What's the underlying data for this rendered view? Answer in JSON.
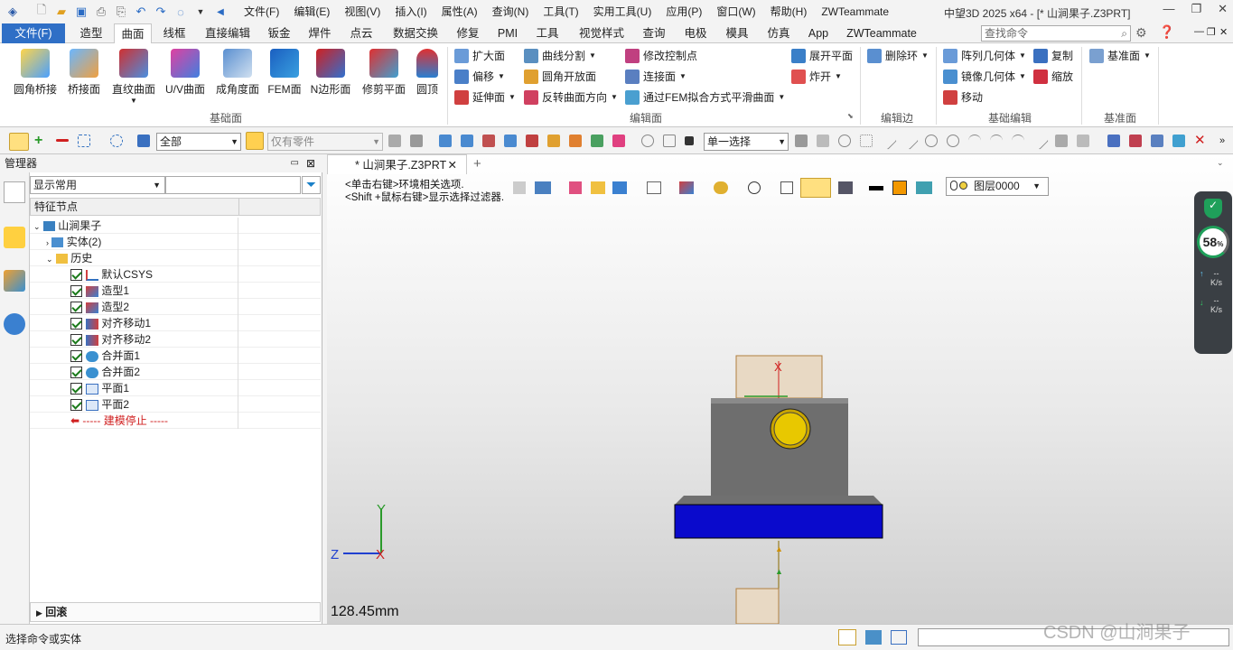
{
  "title_bar": {
    "menus": [
      "文件(F)",
      "编辑(E)",
      "视图(V)",
      "插入(I)",
      "属性(A)",
      "查询(N)",
      "工具(T)",
      "实用工具(U)",
      "应用(P)",
      "窗口(W)",
      "帮助(H)",
      "ZWTeammate"
    ],
    "window_title": "中望3D 2025 x64 - [* 山涧果子.Z3PRT]"
  },
  "ribbon_tabs": [
    "文件(F)",
    "造型",
    "曲面",
    "线框",
    "直接编辑",
    "钣金",
    "焊件",
    "点云",
    "数据交换",
    "修复",
    "PMI",
    "工具",
    "视觉样式",
    "查询",
    "电极",
    "模具",
    "仿真",
    "App",
    "ZWTeammate"
  ],
  "active_tab": "曲面",
  "search_placeholder": "查找命令",
  "ribbon": {
    "big_buttons": [
      "圆角桥接",
      "桥接面",
      "直纹曲面",
      "U/V曲面",
      "成角度面",
      "FEM面",
      "N边形面",
      "修剪平面",
      "圆顶"
    ],
    "group_basic": "基础面",
    "edit_col1": [
      "扩大面",
      "偏移",
      "延伸面"
    ],
    "edit_col2": [
      "曲线分割",
      "圆角开放面",
      "反转曲面方向"
    ],
    "edit_col3": [
      "修改控制点",
      "连接面",
      "通过FEM拟合方式平滑曲面"
    ],
    "edit_col4": [
      "展开平面",
      "炸开"
    ],
    "group_edit_face": "编辑面",
    "delete_loop": "删除环",
    "group_edit_edge": "编辑边",
    "base_edit": [
      "阵列几何体",
      "镜像几何体",
      "移动"
    ],
    "base_edit2": [
      "复制",
      "缩放"
    ],
    "group_base_edit": "基础编辑",
    "datum_plane": "基准面",
    "group_datum": "基准面"
  },
  "toolbar": {
    "filter_all": "全部",
    "filter_part": "仅有零件",
    "select_mode": "单一选择"
  },
  "manager": {
    "title": "管理器",
    "display_mode": "显示常用",
    "column_header": "特征节点",
    "root": "山涧果子",
    "solids": "实体(2)",
    "history": "历史",
    "items": [
      "默认CSYS",
      "造型1",
      "造型2",
      "对齐移动1",
      "对齐移动2",
      "合并面1",
      "合并面2",
      "平面1",
      "平面2"
    ],
    "stop": "----- 建模停止 -----",
    "rollback": "回滚"
  },
  "viewport": {
    "doc_tab": "* 山涧果子.Z3PRT",
    "hint1": "<单击右键>环境相关选项.",
    "hint2": "<Shift +鼠标右键>显示选择过滤器.",
    "layer": "图层0000",
    "scale": "128.45mm",
    "axis_y": "Y",
    "axis_z": "Z",
    "axis_x": "X"
  },
  "widget": {
    "percent": "58",
    "unit": "%",
    "up": "--",
    "down": "--",
    "rate": "K/s"
  },
  "status": {
    "text": "选择命令或实体",
    "watermark": "CSDN @山涧果子"
  }
}
